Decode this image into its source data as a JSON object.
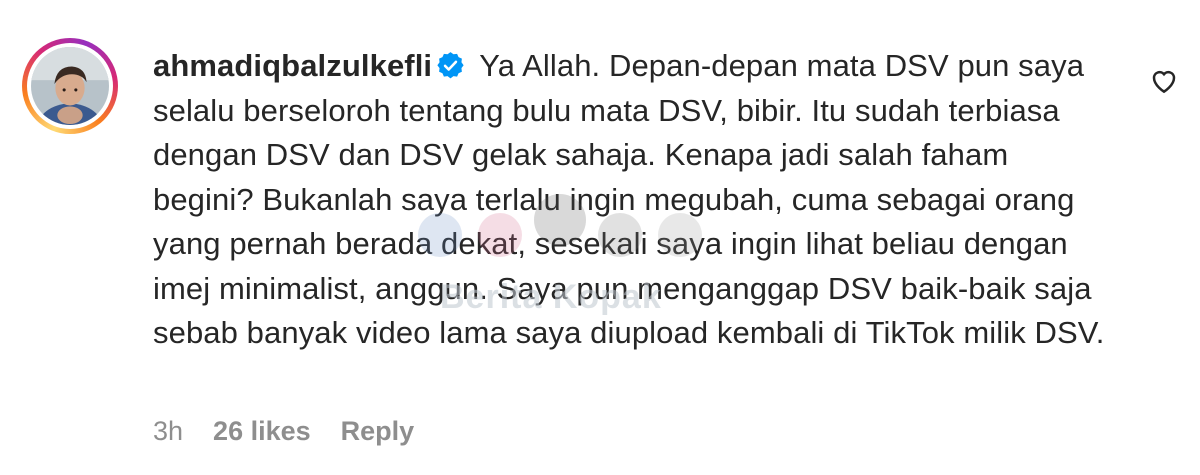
{
  "comment": {
    "username": "ahmadiqbalzulkefli",
    "verified": true,
    "text": "Ya Allah. Depan-depan mata DSV pun saya selalu berseloroh tentang bulu mata DSV, bibir. Itu sudah terbiasa dengan DSV dan DSV gelak sahaja. Kenapa jadi salah faham begini? Bukanlah saya terlalu ingin megubah, cuma sebagai orang yang pernah berada dekat, sesekali saya ingin lihat beliau dengan imej minimalist, anggun. Saya pun menganggap DSV baik-baik saja sebab banyak video lama saya diupload kembali di TikTok milik DSV.",
    "time": "3h",
    "likes": "26 likes",
    "reply_label": "Reply"
  },
  "watermark": {
    "text": "Berita Kopak"
  },
  "icons": {
    "verified": "verified-badge-icon",
    "like": "heart-icon"
  },
  "colors": {
    "text": "#262626",
    "meta": "#8e8e8e",
    "verified": "#0095f6"
  }
}
